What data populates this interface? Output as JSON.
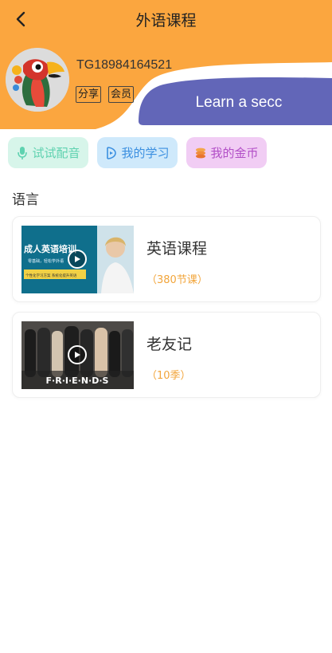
{
  "header": {
    "title": "外语课程",
    "back_icon": "chevron-left-icon",
    "bg_color": "#FBA63F",
    "banner_color": "#6266B8"
  },
  "profile": {
    "user_id": "TG18984164521",
    "tag_share": "分享",
    "tag_member": "会员",
    "banner_text": "Learn a secc"
  },
  "quick_actions": [
    {
      "label": "试试配音",
      "icon": "microphone-icon",
      "color": "#5FD2B0"
    },
    {
      "label": "我的学习",
      "icon": "study-icon",
      "color": "#3B8FE0"
    },
    {
      "label": "我的金币",
      "icon": "coins-icon",
      "color": "#B24FC7"
    }
  ],
  "section": {
    "label": "语言"
  },
  "courses": [
    {
      "name": "英语课程",
      "count": "（380节课）",
      "thumb_title": "成人英语培训",
      "thumb_line1": "零基础，轻松学外语",
      "thumb_line2": "个性化学习方案 系统化提升英语"
    },
    {
      "name": "老友记",
      "count": "（10季）",
      "thumb_title": "F·R·I·E·N·D·S"
    }
  ]
}
